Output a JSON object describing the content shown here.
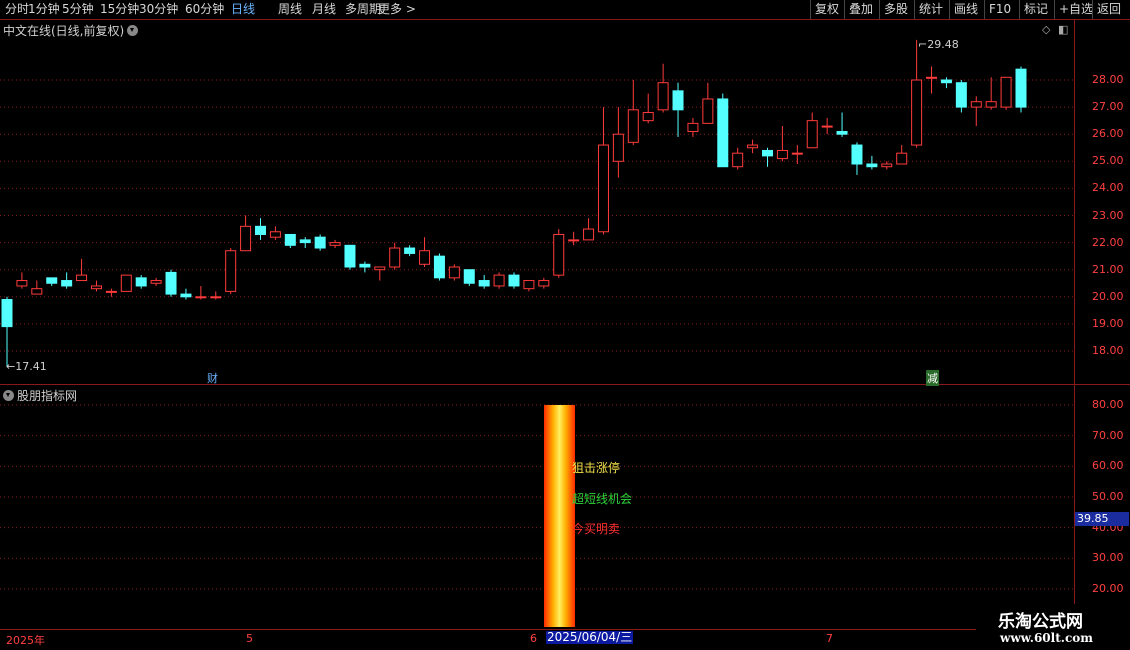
{
  "toolbar": {
    "periods": [
      "分时",
      "1分钟",
      "5分钟",
      "15分钟",
      "30分钟",
      "60分钟",
      "日线",
      "周线",
      "月线",
      "多周期",
      "更多 >"
    ],
    "active_period": "日线",
    "buttons": [
      "复权",
      "叠加",
      "多股",
      "统计",
      "画线",
      "F10",
      "标记",
      "+自选",
      "返回"
    ]
  },
  "main_panel": {
    "title": "中文在线(日线,前复权)",
    "high_label": "29.48",
    "low_label": "17.41",
    "event_labels": [
      "财",
      "减"
    ],
    "y_ticks": [
      "28.00",
      "27.00",
      "26.00",
      "25.00",
      "24.00",
      "23.00",
      "22.00",
      "21.00",
      "20.00",
      "19.00",
      "18.00"
    ]
  },
  "indicator_panel": {
    "title": "股朋指标网",
    "y_ticks": [
      "80.00",
      "70.00",
      "60.00",
      "50.00",
      "40.00",
      "30.00",
      "20.00"
    ],
    "current_value": "39.85",
    "signals": [
      {
        "text": "狙击涨停",
        "color": "#f2e34a"
      },
      {
        "text": "超短线机会",
        "color": "#2fd43a"
      },
      {
        "text": "今买明卖",
        "color": "#ff3030"
      }
    ]
  },
  "time_axis": {
    "labels": [
      "2025年",
      "5",
      "6",
      "7"
    ],
    "current_date": "2025/06/04/三"
  },
  "watermark": {
    "name": "乐淘公式网",
    "url": "www.60lt.com"
  },
  "colors": {
    "up": "#ff3b3b",
    "down": "#54ffff",
    "grid": "#8a1a1a",
    "active": "#6ab4ff"
  },
  "chart_data": {
    "type": "candlestick",
    "ylim": [
      17.3,
      29.7
    ],
    "candles": [
      [
        19.9,
        18.9,
        20.0,
        17.41
      ],
      [
        20.4,
        20.6,
        20.9,
        20.3
      ],
      [
        20.1,
        20.3,
        20.6,
        20.1
      ],
      [
        20.7,
        20.5,
        20.7,
        20.4
      ],
      [
        20.6,
        20.4,
        20.9,
        20.3
      ],
      [
        20.6,
        20.8,
        21.4,
        20.6
      ],
      [
        20.3,
        20.4,
        20.6,
        20.2
      ],
      [
        20.2,
        20.2,
        20.3,
        20.0
      ],
      [
        20.2,
        20.8,
        20.8,
        20.2
      ],
      [
        20.7,
        20.4,
        20.8,
        20.3
      ],
      [
        20.5,
        20.6,
        20.7,
        20.4
      ],
      [
        20.9,
        20.1,
        21.0,
        20.0
      ],
      [
        20.1,
        20.0,
        20.3,
        19.9
      ],
      [
        20.0,
        20.0,
        20.4,
        19.9
      ],
      [
        20.0,
        20.0,
        20.2,
        19.9
      ],
      [
        20.2,
        21.7,
        21.8,
        20.1
      ],
      [
        21.7,
        22.6,
        23.0,
        21.7
      ],
      [
        22.6,
        22.3,
        22.9,
        22.1
      ],
      [
        22.2,
        22.4,
        22.6,
        22.1
      ],
      [
        22.3,
        21.9,
        22.3,
        21.8
      ],
      [
        22.1,
        22.0,
        22.2,
        21.8
      ],
      [
        22.2,
        21.8,
        22.3,
        21.7
      ],
      [
        21.9,
        22.0,
        22.1,
        21.8
      ],
      [
        21.9,
        21.1,
        21.9,
        21.0
      ],
      [
        21.2,
        21.1,
        21.3,
        20.9
      ],
      [
        21.0,
        21.1,
        21.1,
        20.6
      ],
      [
        21.1,
        21.8,
        22.0,
        21.0
      ],
      [
        21.8,
        21.6,
        21.9,
        21.5
      ],
      [
        21.2,
        21.7,
        22.2,
        21.1
      ],
      [
        21.5,
        20.7,
        21.6,
        20.6
      ],
      [
        20.7,
        21.1,
        21.2,
        20.6
      ],
      [
        21.0,
        20.5,
        21.0,
        20.4
      ],
      [
        20.6,
        20.4,
        20.8,
        20.3
      ],
      [
        20.4,
        20.8,
        20.9,
        20.3
      ],
      [
        20.8,
        20.4,
        20.9,
        20.3
      ],
      [
        20.3,
        20.6,
        20.6,
        20.2
      ],
      [
        20.4,
        20.6,
        20.7,
        20.3
      ],
      [
        20.8,
        22.3,
        22.5,
        20.7
      ],
      [
        22.1,
        22.1,
        22.4,
        21.9
      ],
      [
        22.1,
        22.5,
        22.9,
        22.1
      ],
      [
        22.4,
        25.6,
        27.0,
        22.3
      ],
      [
        25.0,
        26.0,
        27.0,
        24.4
      ],
      [
        25.7,
        26.9,
        28.0,
        25.6
      ],
      [
        26.5,
        26.8,
        27.5,
        26.4
      ],
      [
        26.9,
        27.9,
        28.6,
        26.8
      ],
      [
        27.6,
        26.9,
        27.9,
        25.9
      ],
      [
        26.1,
        26.4,
        26.6,
        25.9
      ],
      [
        26.4,
        27.3,
        27.9,
        26.4
      ],
      [
        27.3,
        24.8,
        27.5,
        24.8
      ],
      [
        24.8,
        25.3,
        25.5,
        24.7
      ],
      [
        25.5,
        25.6,
        25.8,
        25.3
      ],
      [
        25.4,
        25.2,
        25.5,
        24.8
      ],
      [
        25.1,
        25.4,
        26.3,
        25.0
      ],
      [
        25.3,
        25.3,
        25.6,
        24.9
      ],
      [
        25.5,
        26.5,
        26.8,
        25.5
      ],
      [
        26.3,
        26.3,
        26.6,
        26.0
      ],
      [
        26.1,
        26.0,
        26.8,
        25.9
      ],
      [
        25.6,
        24.9,
        25.7,
        24.5
      ],
      [
        24.9,
        24.8,
        25.2,
        24.7
      ],
      [
        24.8,
        24.9,
        25.0,
        24.7
      ],
      [
        24.9,
        25.3,
        25.6,
        24.9
      ],
      [
        25.6,
        28.0,
        29.48,
        25.5
      ],
      [
        28.1,
        28.1,
        28.5,
        27.5
      ],
      [
        28.0,
        27.9,
        28.1,
        27.7
      ],
      [
        27.9,
        27.0,
        28.0,
        26.8
      ],
      [
        27.0,
        27.2,
        27.4,
        26.3
      ],
      [
        27.0,
        27.2,
        28.1,
        26.9
      ],
      [
        27.0,
        28.1,
        28.1,
        26.9
      ],
      [
        28.4,
        27.0,
        28.5,
        26.8
      ]
    ]
  }
}
